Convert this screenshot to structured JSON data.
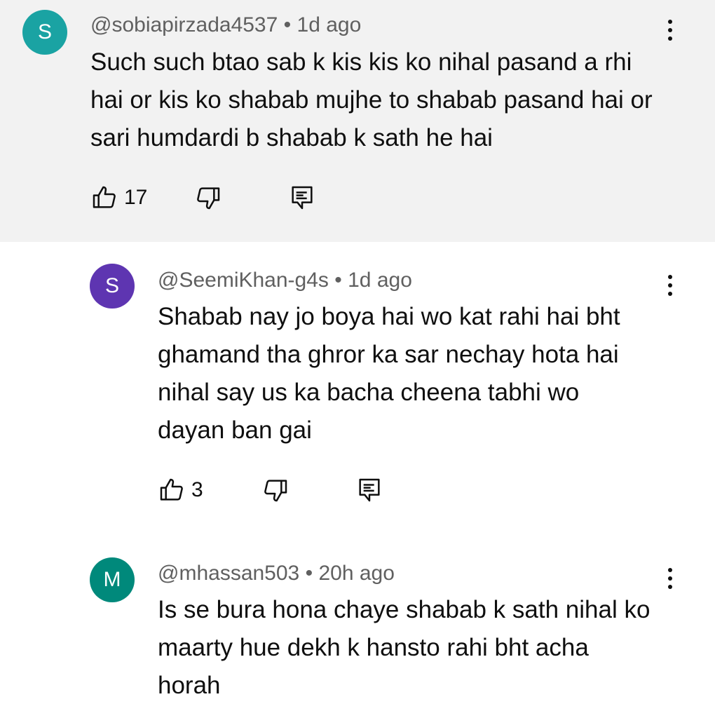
{
  "comments": [
    {
      "avatar_letter": "S",
      "avatar_color": "#1aa3a3",
      "author": "@sobiapirzada4537",
      "separator": "•",
      "time": "1d ago",
      "text": "Such such btao sab k kis kis ko nihal pasand a rhi hai or kis ko shabab mujhe to shabab pasand hai or sari humdardi b shabab k sath he hai",
      "likes": "17"
    },
    {
      "avatar_letter": "S",
      "avatar_color": "#5e35b1",
      "author": "@SeemiKhan-g4s",
      "separator": "•",
      "time": "1d ago",
      "text": "Shabab nay jo boya hai wo kat rahi hai bht ghamand tha ghror ka sar nechay hota hai nihal say us ka bacha cheena tabhi wo dayan ban gai",
      "likes": "3"
    },
    {
      "avatar_letter": "M",
      "avatar_color": "#00897b",
      "author": "@mhassan503",
      "separator": "•",
      "time": "20h ago",
      "text": "Is se bura hona chaye shabab k sath nihal ko maarty hue dekh k hansto rahi bht acha horah"
    }
  ],
  "icons": {
    "like": "thumbs-up-icon",
    "dislike": "thumbs-down-icon",
    "reply": "reply-comment-icon",
    "more": "more-vertical-icon"
  }
}
